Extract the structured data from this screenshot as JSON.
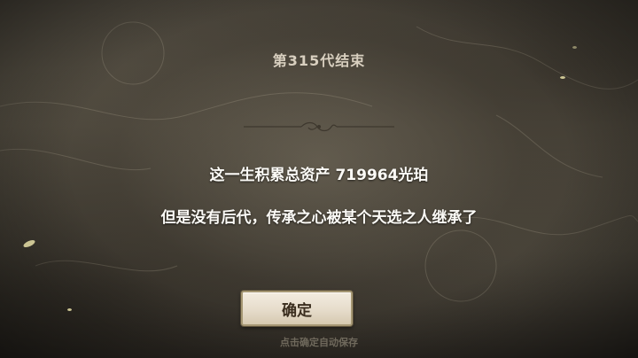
{
  "dialog": {
    "title": "第315代结束",
    "line1": "这一生积累总资产 719964光珀",
    "line2": "但是没有后代，传承之心被某个天选之人继承了",
    "confirm_label": "确定",
    "hint": "点击确定自动保存"
  },
  "colors": {
    "title": "#d8cfbf",
    "body_text": "#fbfaf6",
    "button_bg": "#ece3d3",
    "button_text": "#3a2d1e",
    "hint": "#6f695c"
  }
}
